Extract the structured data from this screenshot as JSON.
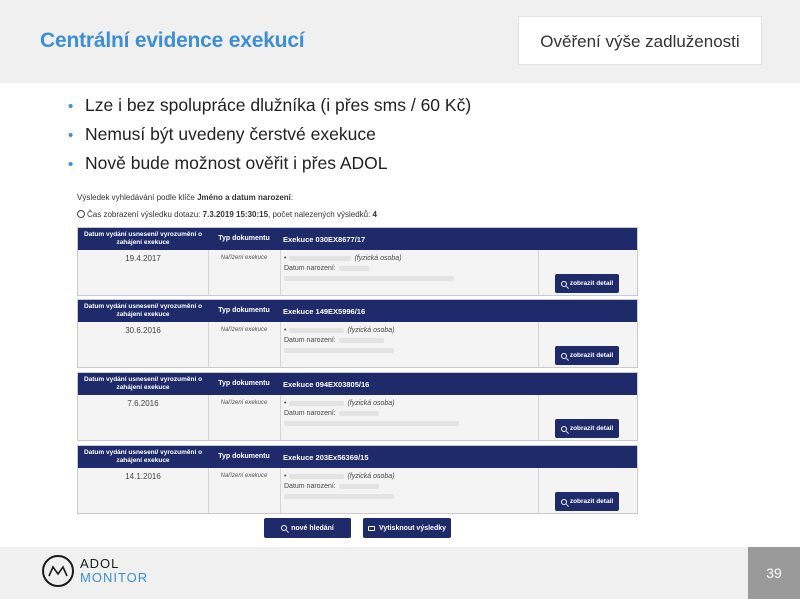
{
  "slide": {
    "title": "Centrální evidence exekucí",
    "box_title": "Ověření výše zadluženosti",
    "bullets": [
      "Lze i bez spolupráce dlužníka (i přes sms / 60 Kč)",
      "Nemusí být uvedeny čerstvé exekuce",
      "Nově bude možnost ověřit i přes ADOL"
    ],
    "page_number": "39"
  },
  "screenshot": {
    "search_info": {
      "prefix": "Výsledek vyhledávání podle klíče",
      "key": "Jméno a datum narození",
      "suffix": ":"
    },
    "time_info": {
      "prefix": "Čas zobrazení výsledku dotazu:",
      "datetime": "7.3.2019 15:30:15",
      "middle": ", počet nalezených výsledků:",
      "count": "4"
    },
    "columns": {
      "date": "Datum vydání usnesení/ vyrozumění o zahájení exekuce",
      "type": "Typ dokumentu"
    },
    "results": [
      {
        "case": "Exekuce 030EX8677/17",
        "date": "19.4.2017",
        "doc_type": "Nařízení exekuce",
        "person_type": "(fyzická osoba)",
        "birth_label": "Datum narození:"
      },
      {
        "case": "Exekuce 149EX5996/16",
        "date": "30.6.2016",
        "doc_type": "Nařízení exekuce",
        "person_type": "(fyzická osoba)",
        "birth_label": "Datum narození:"
      },
      {
        "case": "Exekuce 094EX03805/16",
        "date": "7.6.2016",
        "doc_type": "Nařízení exekuce",
        "person_type": "(fyzická osoba)",
        "birth_label": "Datum narození:"
      },
      {
        "case": "Exekuce 203Ex56369/15",
        "date": "14.1.2016",
        "doc_type": "Nařízení exekuce",
        "person_type": "(fyzická osoba)",
        "birth_label": "Datum narození:"
      }
    ],
    "detail_label": "zobrazit detail",
    "new_search_label": "nové hledání",
    "print_label": "Vytisknout výsledky"
  },
  "logo": {
    "line1": "ADOL",
    "line2": "MONITOR"
  },
  "colors": {
    "title_blue": "#3c8fd6",
    "navy": "#1e2a69"
  }
}
